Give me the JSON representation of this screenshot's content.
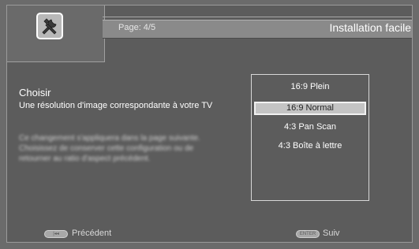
{
  "header": {
    "page_label": "Page: 4/5",
    "title": "Installation facile"
  },
  "main": {
    "heading": "Choisir",
    "description": "Une résolution d'image correspondante à votre TV",
    "blurred_text": "Ce changement s'appliquera dans la page suivante. Choisissez de conserver cette configuration ou de retourner au ratio d'aspect précédent."
  },
  "options": [
    {
      "label": "16:9 Plein",
      "selected": false
    },
    {
      "label": "16:9 Normal",
      "selected": true
    },
    {
      "label": "4:3 Pan Scan",
      "selected": false
    },
    {
      "label": "4:3 Boîte à lettre",
      "selected": false
    }
  ],
  "footer": {
    "back_key": "|◂◂",
    "back_label": "Précédent",
    "next_key": "ENTER",
    "next_label": "Suiv"
  },
  "icons": {
    "setup": "wrench-screwdriver-icon"
  }
}
